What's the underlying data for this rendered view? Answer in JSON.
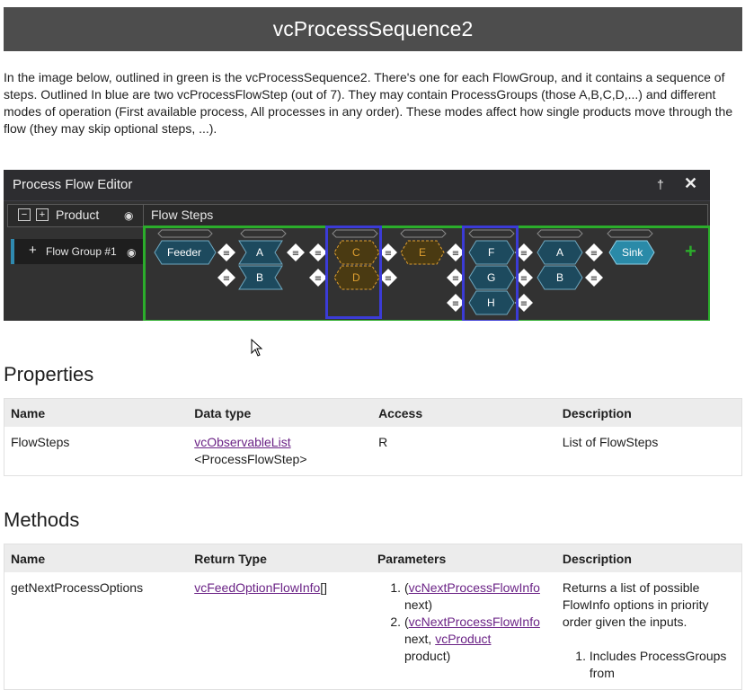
{
  "page_title": "vcProcessSequence2",
  "intro_text": "In the image below, outlined in green is the vcProcessSequence2. There's one for each FlowGroup, and it contains a sequence of steps. Outlined In blue are two vcProcessFlowStep (out of 7). They may contain ProcessGroups (those A,B,C,D,...) and different modes of operation (First available process, All processes in any order). These modes affect how single products move through the flow (they may skip optional steps, ...).",
  "editor": {
    "title": "Process Flow Editor",
    "pin_glyph": "📌",
    "close_glyph": "✖",
    "collapse_glyph": "−",
    "expand_glyph": "+",
    "product_label": "Product",
    "flow_steps_label": "Flow Steps",
    "flow_group_label": "Flow Group #1",
    "flow_group_plus": "+",
    "eye_glyph": "👁",
    "add_glyph": "+",
    "nodes": {
      "feeder": "Feeder",
      "a1": "A",
      "b1": "B",
      "c": "C",
      "d": "D",
      "e": "E",
      "f": "F",
      "g": "G",
      "h": "H",
      "a2": "A",
      "b2": "B",
      "sink": "Sink"
    }
  },
  "properties": {
    "heading": "Properties",
    "headers": [
      "Name",
      "Data type",
      "Access",
      "Description"
    ],
    "row": {
      "name": "FlowSteps",
      "type_link": "vcObservableList",
      "type_rest": "<ProcessFlowStep>",
      "access": "R",
      "description": "List of FlowSteps"
    }
  },
  "methods": {
    "heading": "Methods",
    "headers": [
      "Name",
      "Return Type",
      "Parameters",
      "Description"
    ],
    "row": {
      "name": "getNextProcessOptions",
      "return_link": "vcFeedOptionFlowInfo",
      "return_rest": "[]",
      "param1_open": "(",
      "param1_link": "vcNextProcessFlowInfo",
      "param1_rest": "next)",
      "param2_open": "(",
      "param2_link": "vcNextProcessFlowInfo",
      "param2_mid": "next, ",
      "param2_link2": "vcProduct",
      "param2_rest": "product)",
      "description": "Returns a list of possible FlowInfo options in priority order given the inputs.",
      "desc_item1": "Includes ProcessGroups from"
    }
  }
}
